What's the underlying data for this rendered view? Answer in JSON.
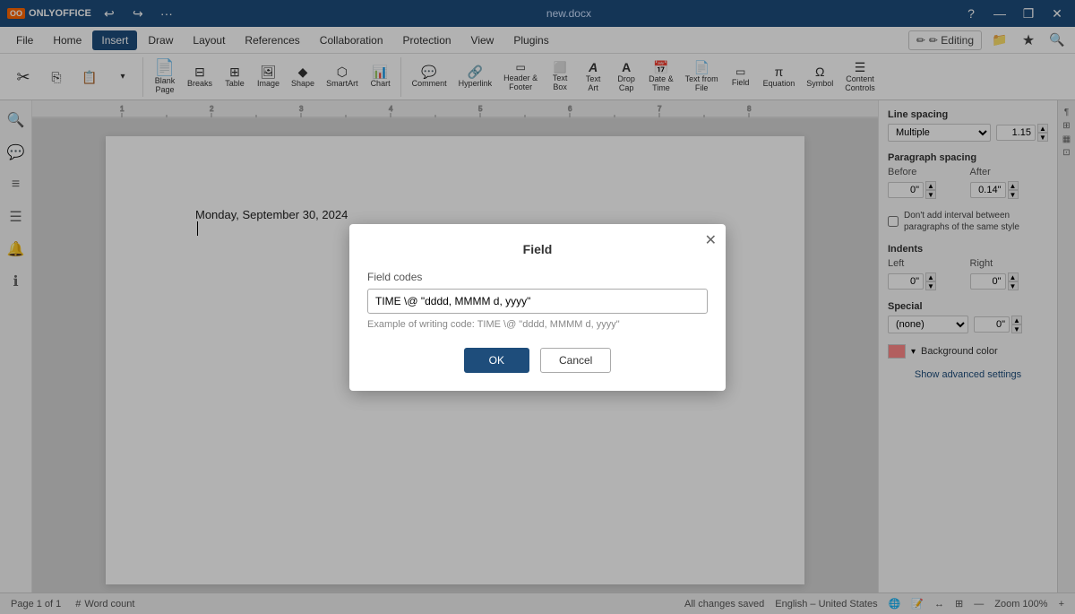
{
  "app": {
    "name": "ONLYOFFICE",
    "logo_text": "ONLYOFFICE",
    "title": "new.docx"
  },
  "titlebar": {
    "minimize": "—",
    "maximize": "❐",
    "close": "✕",
    "restore": "⧉",
    "more": "···",
    "help": "?"
  },
  "menu": {
    "items": [
      "File",
      "Home",
      "Insert",
      "Draw",
      "Layout",
      "References",
      "Collaboration",
      "Protection",
      "View",
      "Plugins"
    ],
    "active": "Insert",
    "editing_label": "✏ Editing",
    "save_to_desktop": "💾",
    "favorite": "★",
    "search": "🔍"
  },
  "toolbar": {
    "tools": [
      {
        "id": "cut",
        "icon": "✂",
        "label": ""
      },
      {
        "id": "copy",
        "icon": "⎘",
        "label": ""
      },
      {
        "id": "paste",
        "icon": "📋",
        "label": ""
      },
      {
        "id": "paste-special",
        "icon": "⬇",
        "label": ""
      },
      {
        "id": "blank-page",
        "icon": "📄",
        "label": "Blank\nPage"
      },
      {
        "id": "breaks",
        "icon": "⊞",
        "label": "Breaks"
      },
      {
        "id": "table",
        "icon": "⊞",
        "label": "Table"
      },
      {
        "id": "image",
        "icon": "🖼",
        "label": "Image"
      },
      {
        "id": "shape",
        "icon": "◆",
        "label": "Shape"
      },
      {
        "id": "smartart",
        "icon": "⬡",
        "label": "SmartArt"
      },
      {
        "id": "chart",
        "icon": "📊",
        "label": "Chart"
      },
      {
        "id": "comment",
        "icon": "💬",
        "label": "Comment"
      },
      {
        "id": "hyperlink",
        "icon": "🔗",
        "label": "Hyperlink"
      },
      {
        "id": "header-footer",
        "icon": "▭",
        "label": "Header &\nFooter"
      },
      {
        "id": "text-box",
        "icon": "⬜",
        "label": "Text\nBox"
      },
      {
        "id": "text-art",
        "icon": "A",
        "label": "Text\nArt"
      },
      {
        "id": "drop-cap",
        "icon": "A",
        "label": "Drop\nCap"
      },
      {
        "id": "date-time",
        "icon": "📅",
        "label": "Date &\nTime"
      },
      {
        "id": "text-from-file",
        "icon": "📄",
        "label": "Text from\nFile"
      },
      {
        "id": "field",
        "icon": "▭",
        "label": "Field"
      },
      {
        "id": "equation",
        "icon": "π",
        "label": "Equation"
      },
      {
        "id": "symbol",
        "icon": "Ω",
        "label": "Symbol"
      },
      {
        "id": "content-controls",
        "icon": "☰",
        "label": "Content\nControls"
      }
    ]
  },
  "left_sidebar": {
    "icons": [
      "🔍",
      "💬",
      "≡",
      "☰",
      "🔔",
      "ℹ"
    ]
  },
  "document": {
    "content": "Monday, September 30, 2024",
    "cursor_visible": true
  },
  "right_panel": {
    "line_spacing": {
      "label": "Line spacing",
      "selected": "Multiple",
      "value": "1.15"
    },
    "paragraph_spacing": {
      "label": "Paragraph spacing",
      "before_label": "Before",
      "after_label": "After",
      "before_value": "0\"",
      "after_value": "0.14\""
    },
    "dont_add_interval": {
      "label": "Don't add interval between paragraphs of the same style",
      "checked": false
    },
    "indents": {
      "label": "Indents",
      "left_label": "Left",
      "right_label": "Right",
      "left_value": "0\"",
      "right_value": "0\""
    },
    "special": {
      "label": "Special",
      "selected": "(none)",
      "value": "0\""
    },
    "background": {
      "label": "Background color"
    },
    "show_advanced": "Show advanced settings"
  },
  "status_bar": {
    "page": "Page 1 of 1",
    "word_count": "Word count",
    "all_changes": "All changes saved",
    "language": "English – United States",
    "zoom": "Zoom 100%"
  },
  "modal": {
    "title": "Field",
    "close_btn": "✕",
    "field_codes_label": "Field codes",
    "field_codes_value": "TIME \\@ \"dddd, MMMM d, yyyy\"",
    "hint": "Example of writing code: TIME \\@ \"dddd, MMMM d, yyyy\"",
    "ok_label": "OK",
    "cancel_label": "Cancel"
  }
}
